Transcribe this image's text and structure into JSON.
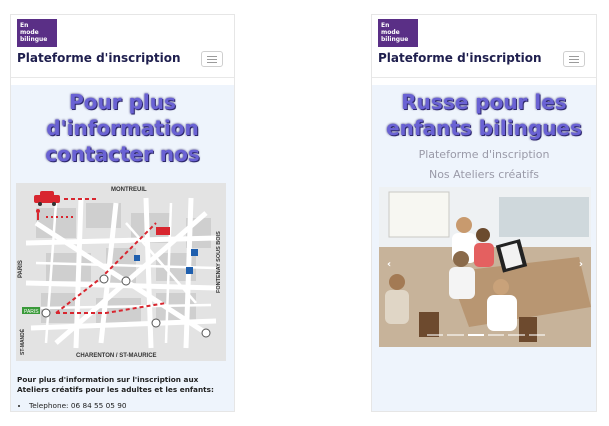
{
  "left": {
    "logo": {
      "line1": "En",
      "line2": "mode",
      "line3": "bilingue"
    },
    "brand": "Plateforme d'inscription",
    "title_lines": [
      "Pour plus",
      "d'information",
      "contacter nos"
    ],
    "map": {
      "labels": {
        "north": "MONTREUIL",
        "west": "PARIS",
        "east": "FONTENAY SOUS BOIS",
        "south": "CHARENTON  /  ST-MAURICE",
        "southwest": "ST-MANDÉ",
        "green_tag": "PARIS"
      }
    },
    "info_text": "Pour plus d'information sur l'inscription aux Ateliers créatifs pour les adultes et les enfants:",
    "phone": "Telephone: 06 84 55 05 90"
  },
  "right": {
    "logo": {
      "line1": "En",
      "line2": "mode",
      "line3": "bilingue"
    },
    "brand": "Plateforme d'inscription",
    "title_lines": [
      "Russe pour les",
      "enfants bilingues"
    ],
    "subtitle1": "Plateforme d'inscription",
    "subtitle2": "Nos Ateliers créatifs",
    "carousel": {
      "prev": "‹",
      "next": "›",
      "slides": 6,
      "active_index": 2
    }
  },
  "colors": {
    "logo_bg": "#5a2f86",
    "title": "#6a62d4",
    "panel_bg": "#eef4fc",
    "map_red": "#d8262f"
  },
  "icons": {
    "menu": "hamburger-icon",
    "prev": "chevron-left-icon",
    "next": "chevron-right-icon"
  }
}
